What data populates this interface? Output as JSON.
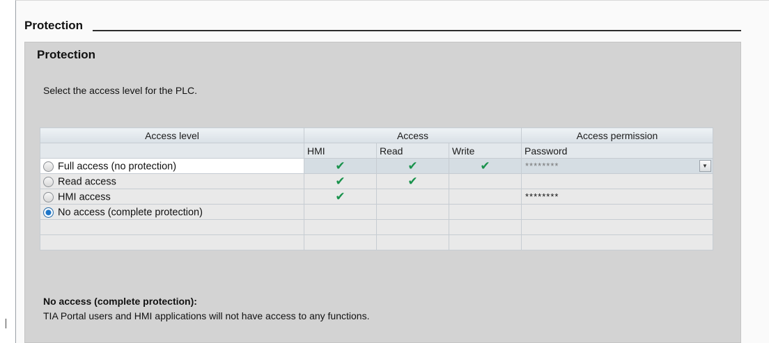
{
  "section": {
    "title": "Protection"
  },
  "panel": {
    "title": "Protection",
    "instruction": "Select the access level for the PLC."
  },
  "table": {
    "group_headers": {
      "access_level": "Access level",
      "access": "Access",
      "access_permission": "Access permission"
    },
    "sub_headers": {
      "hmi": "HMI",
      "read": "Read",
      "write": "Write",
      "password": "Password"
    },
    "rows": [
      {
        "label": "Full access (no protection)",
        "selected": false,
        "hmi": "✔",
        "read": "✔",
        "write": "✔",
        "password": "********"
      },
      {
        "label": "Read access",
        "selected": false,
        "hmi": "✔",
        "read": "✔",
        "write": "",
        "password": ""
      },
      {
        "label": "HMI access",
        "selected": false,
        "hmi": "✔",
        "read": "",
        "write": "",
        "password": "********"
      },
      {
        "label": "No access (complete protection)",
        "selected": true,
        "hmi": "",
        "read": "",
        "write": "",
        "password": ""
      }
    ]
  },
  "description": {
    "title": "No access (complete protection):",
    "text": "TIA Portal users and HMI applications will not have access to any functions."
  },
  "colors": {
    "check": "#19924c",
    "radio_selected": "#1c75c9",
    "panel_bg": "#d3d3d3"
  },
  "icons": {
    "check": "checkmark-icon",
    "dropdown": "chevron-down-icon"
  }
}
